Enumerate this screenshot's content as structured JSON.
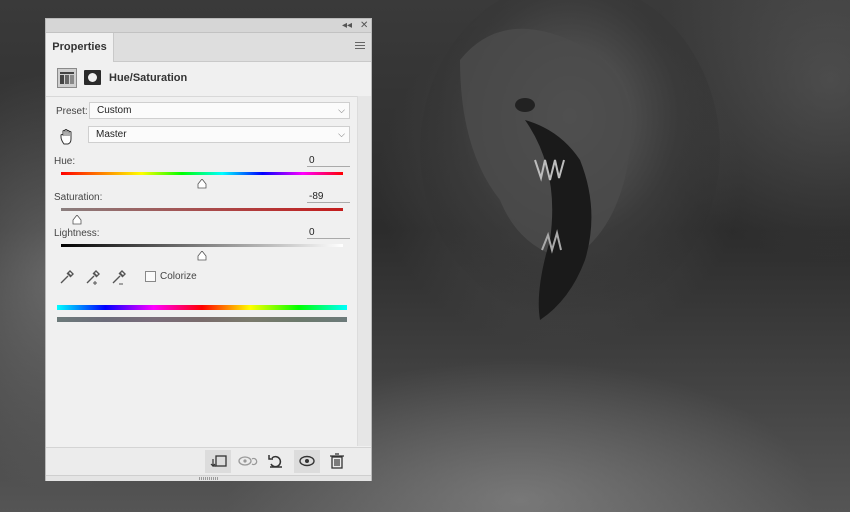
{
  "panel": {
    "tab_label": "Properties",
    "adjustment_title": "Hue/Saturation",
    "preset": {
      "label": "Preset:",
      "value": "Custom"
    },
    "channel": {
      "value": "Master"
    },
    "hue": {
      "label": "Hue:",
      "value": "0",
      "level": 0.5
    },
    "saturation": {
      "label": "Saturation:",
      "value": "-89",
      "level": 0.055
    },
    "lightness": {
      "label": "Lightness:",
      "value": "0",
      "level": 0.5
    },
    "colorize": {
      "label": "Colorize",
      "checked": false
    }
  },
  "titlebar": {
    "collapse_symbol": "◂◂",
    "close_symbol": "✕"
  },
  "icons": {
    "adjustment": "hue-saturation-layer-icon",
    "mask": "layer-mask-icon",
    "hand": "targeted-adjustment-hand-icon",
    "eyedroppers": [
      "eyedropper-icon",
      "eyedropper-plus-icon",
      "eyedropper-minus-icon"
    ],
    "footer": [
      "clip-to-layer-icon",
      "view-previous-state-icon",
      "reset-icon",
      "visibility-eye-icon",
      "trash-icon"
    ]
  },
  "colors": {
    "panel_bg": "#f0f0f0",
    "saturation_track": "#c41c1c"
  }
}
